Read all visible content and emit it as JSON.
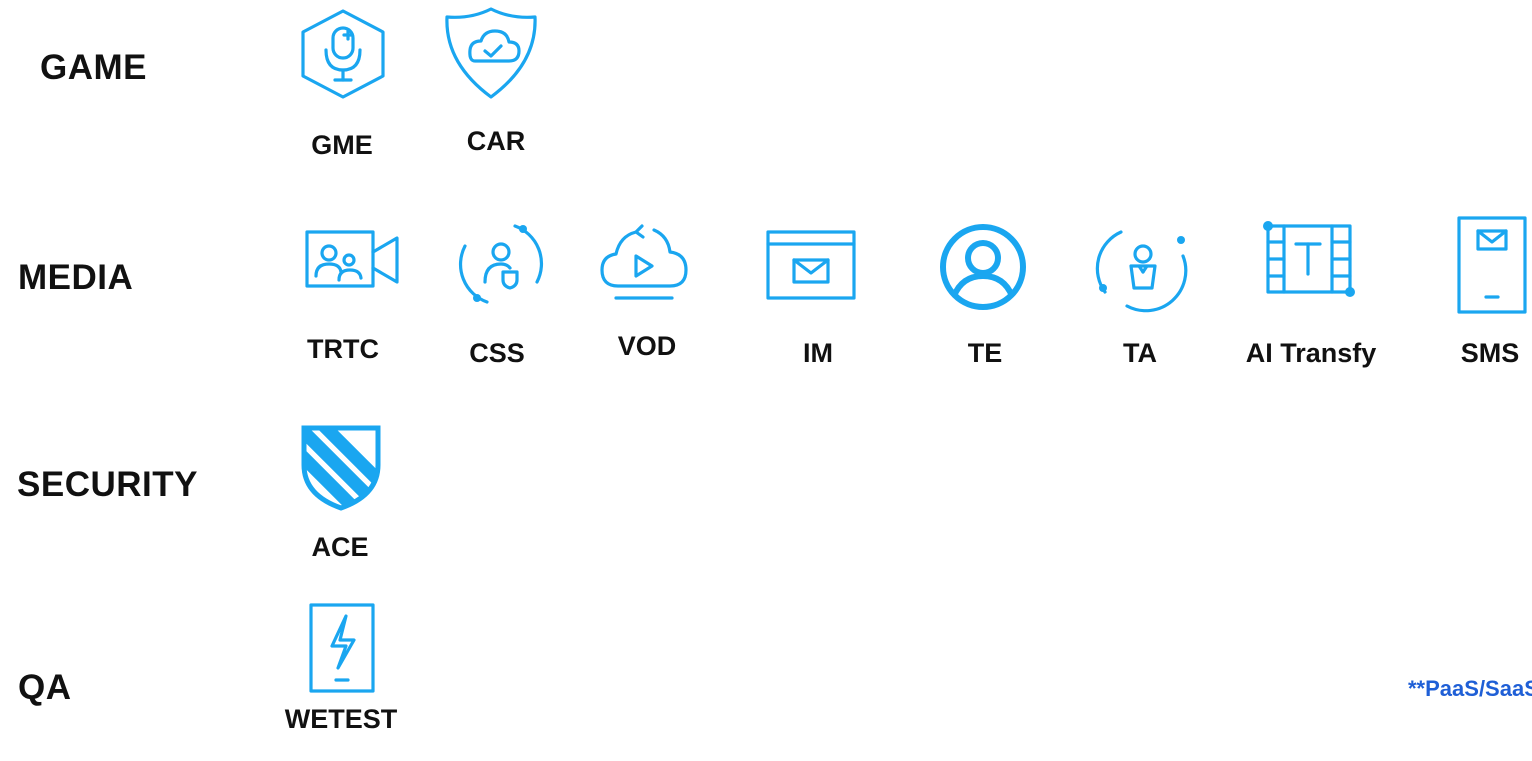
{
  "categories": {
    "game": "GAME",
    "media": "MEDIA",
    "security": "SECURITY",
    "qa": "QA"
  },
  "products": {
    "gme": "GME",
    "car": "CAR",
    "trtc": "TRTC",
    "css": "CSS",
    "vod": "VOD",
    "im": "IM",
    "te": "TE",
    "ta": "TA",
    "ai_transfy": "AI Transfy",
    "sms": "SMS",
    "ace": "ACE",
    "wetest": "WETEST"
  },
  "note": "**PaaS/SaaS",
  "colors": {
    "icon": "#1aa6f0",
    "text": "#111111",
    "note": "#1f5fd6"
  },
  "icons": {
    "gme": "microphone-hexagon-icon",
    "car": "cloud-check-shield-icon",
    "trtc": "video-camera-users-icon",
    "css": "user-shield-circle-icon",
    "vod": "cloud-play-icon",
    "im": "message-window-icon",
    "te": "user-circle-icon",
    "ta": "user-circle-orbit-icon",
    "ai_transfy": "film-text-icon",
    "sms": "mobile-message-icon",
    "ace": "striped-shield-icon",
    "wetest": "mobile-lightning-icon"
  }
}
